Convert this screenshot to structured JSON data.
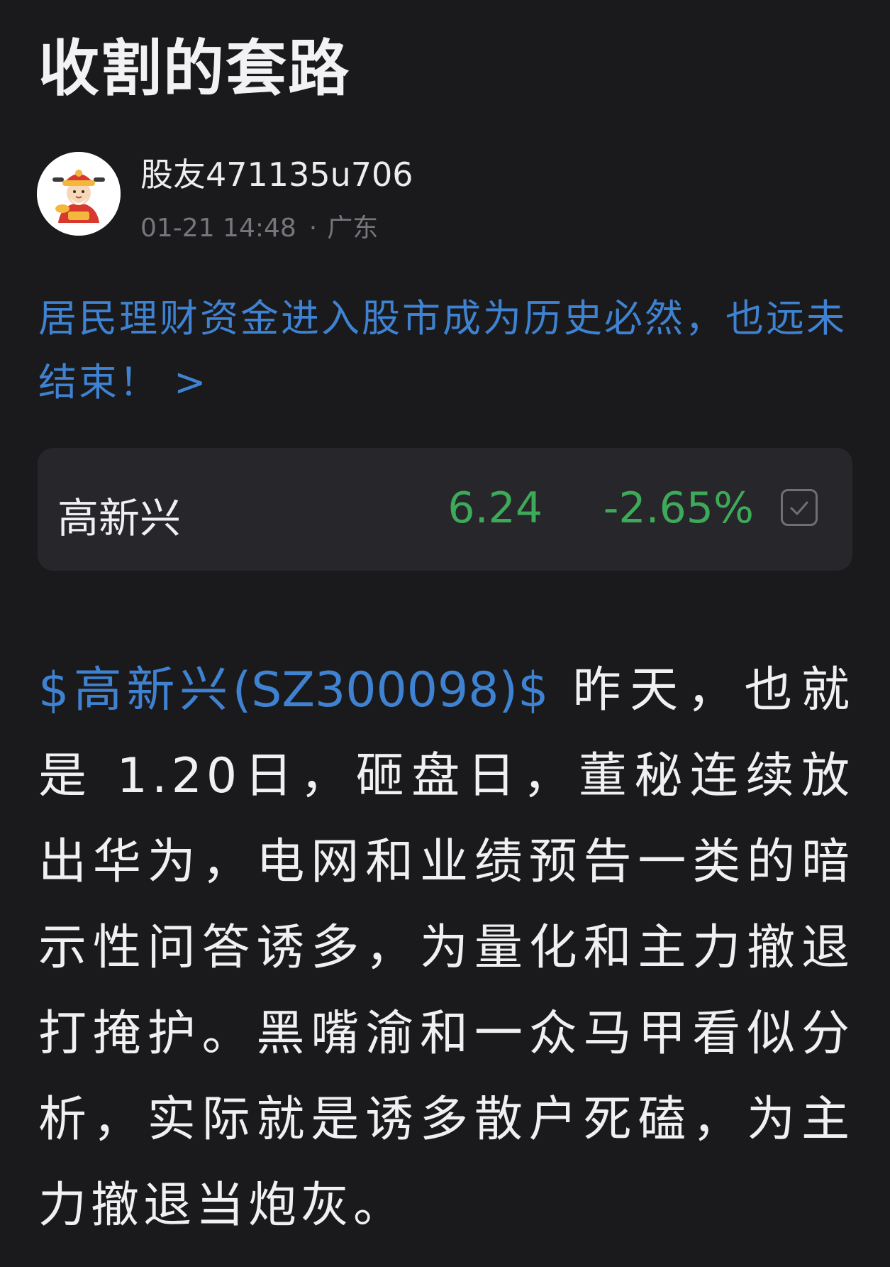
{
  "post": {
    "title": "收割的套路"
  },
  "author": {
    "name": "股友471135u706",
    "timestamp": "01-21 14:48",
    "separator": "·",
    "location": "广东",
    "avatar_icon": "fortune-god-avatar-icon"
  },
  "topic": {
    "text": "居民理财资金进入股市成为历史必然，也远未结束！ >",
    "color": "#3f82d1"
  },
  "stock_card": {
    "name": "高新兴",
    "price": "6.24",
    "change": "-2.65%",
    "change_color": "#3daa5a",
    "watch_icon": "checkbox-check-icon"
  },
  "content": {
    "stock_tag": "$高新兴(SZ300098)$",
    "text": " 昨天，也就是 1.20日，砸盘日，董秘连续放出华为，电网和业绩预告一类的暗示性问答诱多，为量化和主力撤退打掩护。黑嘴渝和一众马甲看似分析，实际就是诱多散户死磕，为主力撤退当炮灰。"
  },
  "colors": {
    "background": "#1a1a1c",
    "card_background": "#27272b",
    "link": "#3f82d1",
    "down": "#3daa5a"
  }
}
